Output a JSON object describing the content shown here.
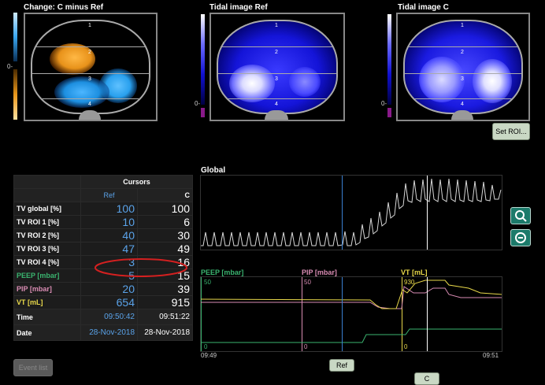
{
  "images": {
    "change": {
      "title": "Change: C minus Ref",
      "zero": "0-"
    },
    "tidal_ref": {
      "title": "Tidal image Ref",
      "zero": "0-"
    },
    "tidal_c": {
      "title": "Tidal image C",
      "zero": "0-"
    },
    "roi_labels": [
      "1",
      "2",
      "3",
      "4"
    ]
  },
  "buttons": {
    "set_roi": "Set ROI...",
    "event_list": "Event list",
    "ref": "Ref",
    "c": "C"
  },
  "table": {
    "header": "Cursors",
    "col_ref": "Ref",
    "col_c": "C",
    "rows": [
      {
        "label": "TV global [%]",
        "ref": "100",
        "c": "100",
        "color": "#ffffff"
      },
      {
        "label": "TV ROI 1 [%]",
        "ref": "10",
        "c": "6",
        "color": "#ffffff"
      },
      {
        "label": "TV ROI 2 [%]",
        "ref": "40",
        "c": "30",
        "color": "#ffffff"
      },
      {
        "label": "TV ROI 3 [%]",
        "ref": "47",
        "c": "49",
        "color": "#ffffff"
      },
      {
        "label": "TV ROI 4 [%]",
        "ref": "3",
        "c": "16",
        "color": "#ffffff"
      },
      {
        "label": "PEEP [mbar]",
        "ref": "5",
        "c": "15",
        "color": "#3ab36f"
      },
      {
        "label": "PIP [mbar]",
        "ref": "20",
        "c": "39",
        "color": "#d98cb3"
      },
      {
        "label": "VT [mL]",
        "ref": "654",
        "c": "915",
        "color": "#e8d84a"
      }
    ],
    "time_label": "Time",
    "time_ref": "09:50:42",
    "time_c": "09:51:22",
    "date_label": "Date",
    "date_ref": "28-Nov-2018",
    "date_c": "28-Nov-2018"
  },
  "global_chart": {
    "title": "Global"
  },
  "trend_chart": {
    "peep_label": "PEEP [mbar]",
    "pip_label": "PIP [mbar]",
    "vt_label": "VT [mL]",
    "peep_max": "50",
    "peep_min": "0",
    "pip_max": "50",
    "pip_min": "0",
    "vt_max": "930",
    "vt_min": "0",
    "time_start": "09:49",
    "time_end": "09:51"
  },
  "icons": {
    "zoom": "magnifier-icon",
    "zoom_out": "zoom-out-icon"
  },
  "colors": {
    "ref_cursor": "#3a7fd0",
    "c_cursor": "#ffffff",
    "peep": "#3ab36f",
    "pip": "#d98cb3",
    "vt": "#e8d84a",
    "highlight_ellipse": "#d42020"
  }
}
